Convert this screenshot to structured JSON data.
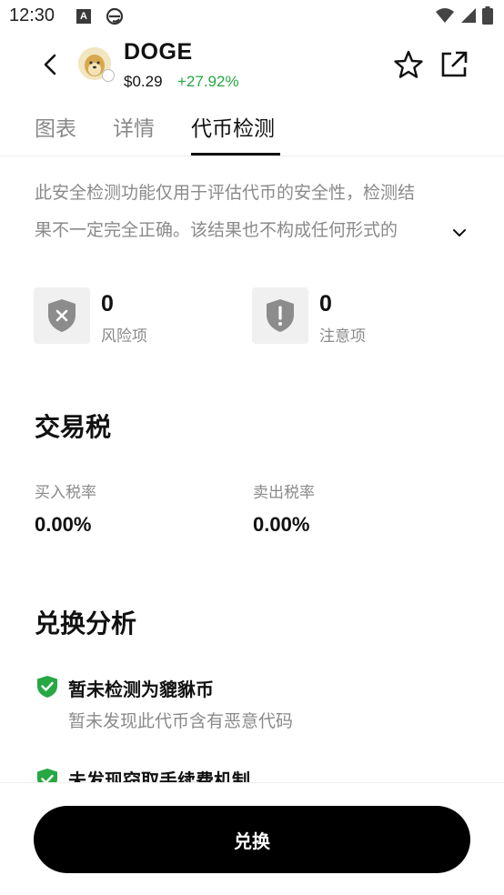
{
  "status_bar": {
    "time": "12:30",
    "a_icon": "A"
  },
  "header": {
    "token_symbol": "DOGE",
    "price": "$0.29",
    "change": "+27.92%",
    "change_color": "#27a844"
  },
  "tabs": [
    {
      "label": "图表",
      "active": false
    },
    {
      "label": "详情",
      "active": false
    },
    {
      "label": "代币检测",
      "active": true
    }
  ],
  "notice": {
    "line1": "此安全检测功能仅用于评估代币的安全性，检测结",
    "line2": "果不一定完全正确。该结果也不构成任何形式的"
  },
  "risk_summary": {
    "risk": {
      "count": "0",
      "label": "风险项",
      "icon": "shield-x-icon"
    },
    "attention": {
      "count": "0",
      "label": "注意项",
      "icon": "shield-exclamation-icon"
    }
  },
  "tax": {
    "title": "交易税",
    "buy_label": "买入税率",
    "buy_value": "0.00%",
    "sell_label": "卖出税率",
    "sell_value": "0.00%"
  },
  "analysis": {
    "title": "兑换分析",
    "items": [
      {
        "title": "暂未检测为貔貅币",
        "desc": "暂未发现此代币含有恶意代码",
        "icon": "shield-check-icon"
      },
      {
        "title": "未发现窃取手续费机制",
        "icon": "shield-check-icon"
      }
    ],
    "check_color": "#27a844"
  },
  "action": {
    "swap_label": "兑换"
  }
}
